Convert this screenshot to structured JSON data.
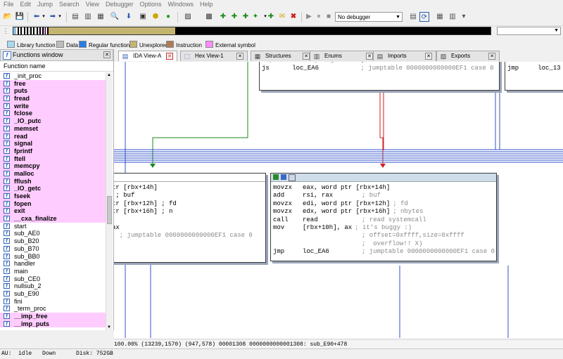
{
  "menu": [
    "File",
    "Edit",
    "Jump",
    "Search",
    "View",
    "Debugger",
    "Options",
    "Windows",
    "Help"
  ],
  "toolbar": {
    "debugger_select": "No debugger"
  },
  "legend": [
    {
      "label": "Library function",
      "color": "#a6d9f1"
    },
    {
      "label": "Data",
      "color": "#bdbdbd"
    },
    {
      "label": "Regular function",
      "color": "#2b7ce0"
    },
    {
      "label": "Unexplored",
      "color": "#c3b470"
    },
    {
      "label": "Instruction",
      "color": "#b07c55"
    },
    {
      "label": "External symbol",
      "color": "#ff8cff"
    }
  ],
  "tabs": [
    {
      "label": "IDA View-A",
      "icon": "ida-view-icon",
      "active": true
    },
    {
      "label": "Hex View-1",
      "icon": "hex-view-icon",
      "active": false
    },
    {
      "label": "Structures",
      "icon": "structures-icon",
      "active": false
    },
    {
      "label": "Enums",
      "icon": "enums-icon",
      "active": false
    },
    {
      "label": "Imports",
      "icon": "imports-icon",
      "active": false
    },
    {
      "label": "Exports",
      "icon": "exports-icon",
      "active": false
    }
  ],
  "functions_window": {
    "title": "Functions window",
    "column_header": "Function name",
    "items": [
      {
        "name": "_init_proc",
        "external": false
      },
      {
        "name": "free",
        "external": true
      },
      {
        "name": "puts",
        "external": true
      },
      {
        "name": "fread",
        "external": true
      },
      {
        "name": "write",
        "external": true
      },
      {
        "name": "fclose",
        "external": true
      },
      {
        "name": "_IO_putc",
        "external": true
      },
      {
        "name": "memset",
        "external": true
      },
      {
        "name": "read",
        "external": true
      },
      {
        "name": "signal",
        "external": true
      },
      {
        "name": "fprintf",
        "external": true
      },
      {
        "name": "ftell",
        "external": true
      },
      {
        "name": "memcpy",
        "external": true
      },
      {
        "name": "malloc",
        "external": true
      },
      {
        "name": "fflush",
        "external": true
      },
      {
        "name": "_IO_getc",
        "external": true
      },
      {
        "name": "fseek",
        "external": true
      },
      {
        "name": "fopen",
        "external": true
      },
      {
        "name": "exit",
        "external": true
      },
      {
        "name": "__cxa_finalize",
        "external": true
      },
      {
        "name": "start",
        "external": false
      },
      {
        "name": "sub_AE0",
        "external": false
      },
      {
        "name": "sub_B20",
        "external": false
      },
      {
        "name": "sub_B70",
        "external": false
      },
      {
        "name": "sub_BB0",
        "external": false
      },
      {
        "name": "handler",
        "external": false
      },
      {
        "name": "main",
        "external": false
      },
      {
        "name": "sub_CE0",
        "external": false
      },
      {
        "name": "nullsub_2",
        "external": false
      },
      {
        "name": "sub_E90",
        "external": false
      },
      {
        "name": "fini",
        "external": false
      },
      {
        "name": "_term_proc",
        "external": false
      },
      {
        "name": "__imp_free",
        "external": true
      },
      {
        "name": "__imp_puts",
        "external": true
      }
    ]
  },
  "graph": {
    "top_block_lines": [
      {
        "mnem": "js",
        "op": "loc_EA6",
        "comment": "; jumptable 0000000000000EF1 case 0"
      }
    ],
    "top_right_lines": [
      {
        "mnem": "jmp",
        "op": "loc_13"
      }
    ],
    "left_block_lines": [
      {
        "text": "tr [rbx+14h]"
      },
      {
        "text": " ; buf"
      },
      {
        "text": "tr [rbx+12h] ; fd"
      },
      {
        "text": "tr [rbx+16h] ; n"
      },
      {
        "text": ""
      },
      {
        "text": "ax"
      },
      {
        "text": "  ; jumptable 0000000000000EF1 case 0"
      }
    ],
    "main_block_lines": [
      {
        "mnem": "movzx",
        "op": "eax, word ptr [rbx+14h]",
        "comment": ""
      },
      {
        "mnem": "add",
        "op": "rsi, rax",
        "comment": "; buf"
      },
      {
        "mnem": "movzx",
        "op": "edi, word ptr [rbx+12h]",
        "comment": "; fd"
      },
      {
        "mnem": "movzx",
        "op": "edx, word ptr [rbx+16h]",
        "comment": "; nbytes"
      },
      {
        "mnem": "call",
        "op": "read",
        "comment": "; read systemcall"
      },
      {
        "mnem": "mov",
        "op": "[rbx+10h], ax",
        "comment": "; it's buggy :)"
      },
      {
        "mnem": "",
        "op": "",
        "comment": "; offset=0xffff,size=0xffff"
      },
      {
        "mnem": "",
        "op": "",
        "comment": ";  overflow!! X)"
      },
      {
        "mnem": "jmp",
        "op": "loc_EA6",
        "comment": "; jumptable 0000000000000EF1 case 0"
      }
    ]
  },
  "info_line": "100.00% (13239,1570) (947,578) 00001308 0000000000001308: sub_E90+478",
  "status": {
    "au_label": "AU:",
    "au_value": "idle",
    "direction": "Down",
    "disk": "Disk: 752GB"
  },
  "colors": {
    "edge_green": "#1a8a1a",
    "edge_red": "#d22020",
    "edge_blue": "#3050c8",
    "external_bg": "#ffccff",
    "block_header": "#cfdde8"
  }
}
